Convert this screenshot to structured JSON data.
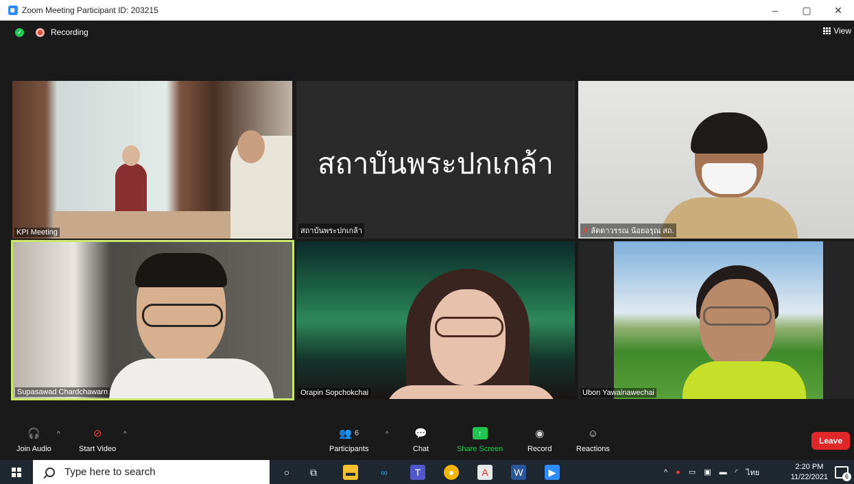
{
  "window": {
    "title": "Zoom Meeting Participant ID: 203215",
    "minimize": "–",
    "maximize": "▢",
    "close": "✕"
  },
  "topbar": {
    "recording_label": "Recording",
    "view_label": "View"
  },
  "tiles": [
    {
      "name": "KPI Meeting"
    },
    {
      "name": "สถาบันพระปกเกล้า",
      "display_text": "สถาบันพระปกเกล้า"
    },
    {
      "name": "ลัดดาวรรณ น้อยอรุณ สถ."
    },
    {
      "name": "Supasawad Chardchawarn",
      "active_speaker": true
    },
    {
      "name": "Orapin Sopchokchai"
    },
    {
      "name": "Ubon Yawainawechai"
    }
  ],
  "toolbar": {
    "join_audio": "Join Audio",
    "start_video": "Start Video",
    "participants": "Participants",
    "participants_count": "6",
    "chat": "Chat",
    "share_screen": "Share Screen",
    "record": "Record",
    "reactions": "Reactions",
    "leave": "Leave"
  },
  "taskbar": {
    "search_placeholder": "Type here to search",
    "language": "ไทย",
    "time": "2:20 PM",
    "date": "11/22/2021",
    "notification_count": "6"
  },
  "colors": {
    "share_green": "#23c552",
    "leave_red": "#e02828",
    "active_speaker_border": "#c9e86b"
  }
}
